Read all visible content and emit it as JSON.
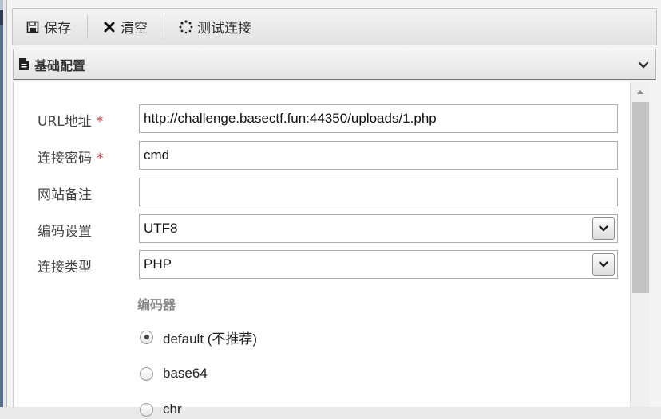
{
  "toolbar": {
    "save_label": "保存",
    "clear_label": "清空",
    "test_label": "测试连接"
  },
  "section": {
    "title": "基础配置"
  },
  "form": {
    "url": {
      "label": "URL地址",
      "required": "*",
      "value": "http://challenge.basectf.fun:44350/uploads/1.php"
    },
    "password": {
      "label": "连接密码",
      "required": "*",
      "value": "cmd"
    },
    "note": {
      "label": "网站备注",
      "value": ""
    },
    "encoding": {
      "label": "编码设置",
      "value": "UTF8"
    },
    "type": {
      "label": "连接类型",
      "value": "PHP"
    },
    "encoder": {
      "title": "编码器",
      "options": [
        {
          "label": "default (不推荐)",
          "selected": true
        },
        {
          "label": "base64",
          "selected": false
        },
        {
          "label": "chr",
          "selected": false
        }
      ]
    }
  },
  "icons": {
    "save": "floppy-disk-icon",
    "clear": "close-icon",
    "test": "spinner-icon",
    "section": "document-icon",
    "collapse": "chevron-down-icon"
  },
  "colors": {
    "required": "#e03030",
    "toolbar_bg": "#e9e9e9",
    "header_border": "#777777"
  }
}
